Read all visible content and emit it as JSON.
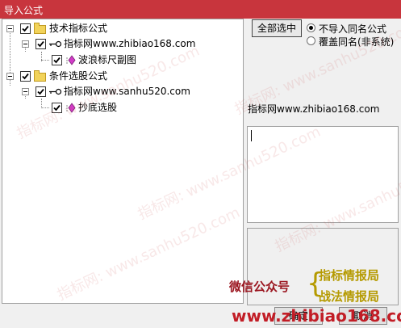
{
  "window": {
    "title": "导入公式"
  },
  "tree": {
    "nodes": [
      {
        "label": "技术指标公式",
        "checked": true
      },
      {
        "label": "指标网www.zhibiao168.com",
        "checked": true
      },
      {
        "label": "波浪标尺副图",
        "checked": true
      },
      {
        "label": "条件选股公式",
        "checked": true
      },
      {
        "label": "指标网www.sanhu520.com",
        "checked": true
      },
      {
        "label": "抄底选股",
        "checked": true
      }
    ]
  },
  "options": {
    "select_all_label": "全部选中",
    "radio_skip_label": "不导入同名公式",
    "radio_overwrite_label": "覆盖同名(非系统)",
    "selected": "radio_skip"
  },
  "info_text": "指标网www.zhibiao168.com",
  "buttons": {
    "ok_label": "确定",
    "cancel_label": "取消"
  },
  "watermark": {
    "text": "指标网: www.sanhu520.com"
  },
  "promo": {
    "wechat": "微信公众号",
    "account1": "指标情报局",
    "account2": "战法情报局",
    "url": "www.zhibiao168.com"
  },
  "colors": {
    "titlebar": "#c8353d",
    "promo_red": "#c21d26",
    "promo_gold": "#b59a00"
  }
}
